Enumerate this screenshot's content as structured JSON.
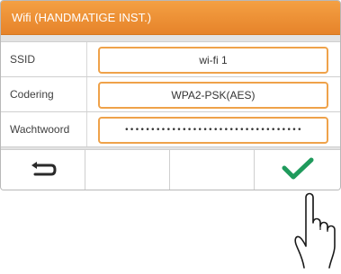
{
  "title": "Wifi (HANDMATIGE INST.)",
  "rows": [
    {
      "label": "SSID",
      "value": "wi-fi 1"
    },
    {
      "label": "Codering",
      "value": "WPA2-PSK(AES)"
    },
    {
      "label": "Wachtwoord",
      "value": "••••••••••••••••••••••••••••••••••"
    }
  ],
  "buttons": [
    {
      "name": "back",
      "icon": "back-arrow-icon"
    },
    {
      "name": "empty-1",
      "icon": ""
    },
    {
      "name": "empty-2",
      "icon": ""
    },
    {
      "name": "confirm",
      "icon": "checkmark-icon",
      "color": "#1f9a5c"
    }
  ],
  "colors": {
    "accent": "#ef9a3c",
    "confirm": "#1f9a5c"
  }
}
